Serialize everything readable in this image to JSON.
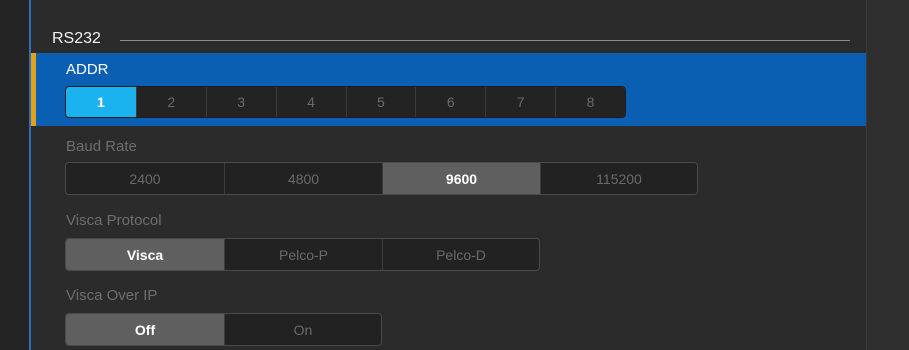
{
  "section": {
    "title": "RS232"
  },
  "addr": {
    "label": "ADDR",
    "options": [
      "1",
      "2",
      "3",
      "4",
      "5",
      "6",
      "7",
      "8"
    ],
    "selected": "1"
  },
  "baud": {
    "label": "Baud Rate",
    "options": [
      "2400",
      "4800",
      "9600",
      "115200"
    ],
    "selected": "9600"
  },
  "protocol": {
    "label": "Visca Protocol",
    "options": [
      "Visca",
      "Pelco-P",
      "Pelco-D"
    ],
    "selected": "Visca"
  },
  "visca_ip": {
    "label": "Visca Over IP",
    "options": [
      "Off",
      "On"
    ],
    "selected": "Off"
  },
  "colors": {
    "accent_blue": "#0a5fb3",
    "selected_cyan": "#1ab3f0",
    "accent_orange": "#e3a21a",
    "background": "#2b2b2b"
  }
}
